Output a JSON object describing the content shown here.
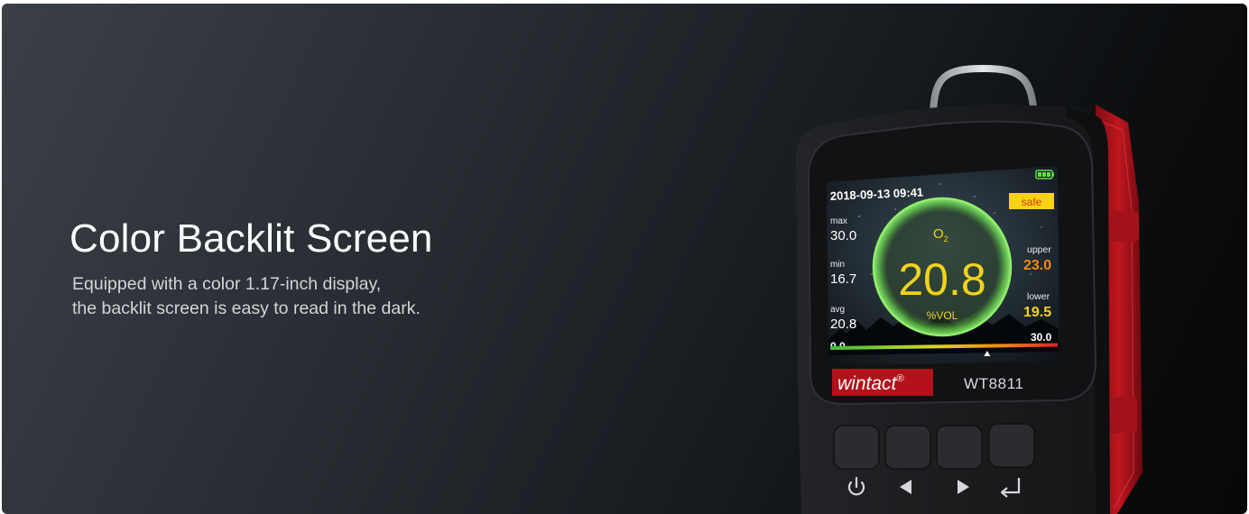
{
  "hero": {
    "title": "Color Backlit Screen",
    "description_line1": "Equipped with a color 1.17-inch display,",
    "description_line2": "the backlit screen is easy to read in the dark."
  },
  "device": {
    "brand": "wintact",
    "brand_mark": "®",
    "model": "WT8811",
    "screen": {
      "datetime": "2018-09-13 09:41",
      "status": "safe",
      "gas_symbol": "O",
      "gas_subscript": "2",
      "reading": "20.8",
      "unit": "%VOL",
      "max_label": "max",
      "max_value": "30.0",
      "min_label": "min",
      "min_value": "16.7",
      "avg_label": "avg",
      "avg_value": "20.8",
      "upper_label": "upper",
      "upper_value": "23.0",
      "lower_label": "lower",
      "lower_value": "19.5",
      "scale_min": "0.0",
      "scale_max": "30.0",
      "scale_level": 0.69
    },
    "buttons": [
      "power-icon",
      "left-arrow-icon",
      "right-arrow-icon",
      "enter-icon"
    ],
    "colors": {
      "body": "#1b1c1e",
      "accent_red": "#b3121a",
      "reading_yellow": "#f2d21c",
      "limit_orange": "#f08a16",
      "ring_green": "#7be25a",
      "status_bg": "#f6d21a"
    }
  }
}
